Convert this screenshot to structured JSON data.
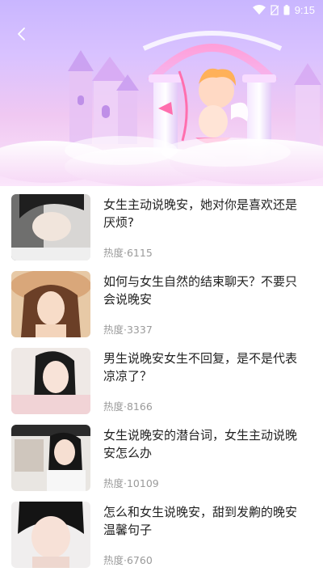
{
  "status_bar": {
    "time": "9:15"
  },
  "header": {
    "back_icon": "chevron-left-icon"
  },
  "articles": [
    {
      "title": "女生主动说晚安，她对你是喜欢还是厌烦?",
      "heat": "热度·6115"
    },
    {
      "title": "如何与女生自然的结束聊天？不要只会说晚安",
      "heat": "热度·3337"
    },
    {
      "title": "男生说晚安女生不回复，是不是代表凉凉了？",
      "heat": "热度·8166"
    },
    {
      "title": "女生说晚安的潜台词，女生主动说晚安怎么办",
      "heat": "热度·10109"
    },
    {
      "title": "怎么和女生说晚安，甜到发齁的晚安温馨句子",
      "heat": "热度·6760"
    }
  ]
}
